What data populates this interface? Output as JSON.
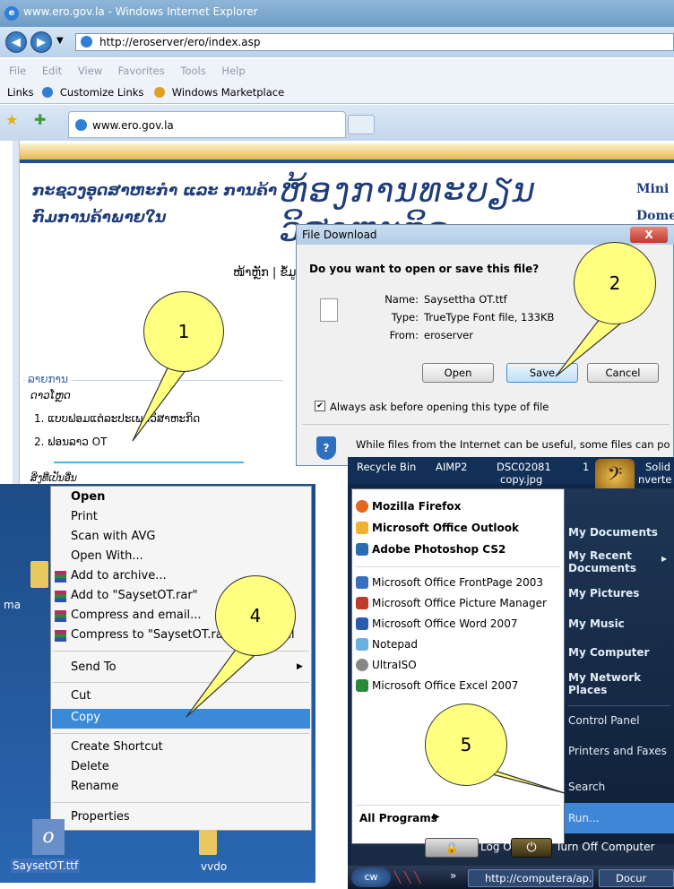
{
  "browser": {
    "title": "www.ero.gov.la - Windows Internet Explorer",
    "address": "http://eroserver/ero/index.asp",
    "menu": [
      "File",
      "Edit",
      "View",
      "Favorites",
      "Tools",
      "Help"
    ],
    "links_label": "Links",
    "links": [
      "Customize Links",
      "Windows Marketplace"
    ],
    "tab_label": "www.ero.gov.la"
  },
  "site": {
    "left_title_1": "ກະຊວງອຸດສາຫະກຳ ແລະ ການຄ້າ",
    "left_title_2": "ກົມການຄ້າພາຍໃນ",
    "big_title": "ຫ້ອງການທະບຽນວິສາຫະກິດ",
    "right_1": "Mini",
    "right_2": "Dome",
    "breadcrumb": "ໜ້າຫຼັກ | ຂໍ້ມູນຂ່າວ",
    "menu_title": "ລາຍການ",
    "menu_sub": "ດາວໂຫຼດ",
    "menu_item_1": "1. ແບບຟອມແຕ່ລະປະເພດວິສາຫະກິດ",
    "menu_item_2": "2. ຟອນລາວ OT",
    "menu_more": "ສິ່ງທີ່ເປັນອື່ນ"
  },
  "dialog": {
    "title": "File Download",
    "close": "X",
    "question": "Do you want to open or save this file?",
    "name_label": "Name:",
    "name_value": "Saysettha OT.ttf",
    "type_label": "Type:",
    "type_value": "TrueType Font file, 133KB",
    "from_label": "From:",
    "from_value": "eroserver",
    "open": "Open",
    "save": "Save",
    "cancel": "Cancel",
    "checkbox_checked": true,
    "checkbox_label": "Always ask before opening this type of file",
    "warning": "While files from the Internet can be useful, some files can potentially"
  },
  "context_menu": {
    "items": [
      "Open",
      "Print",
      "Scan with AVG",
      "Open With...",
      "Add to archive...",
      "Add to \"SaysetOT.rar\"",
      "Compress and email...",
      "Compress to \"SaysetOT.rar\" and email",
      "Send To",
      "Cut",
      "Copy",
      "Create Shortcut",
      "Delete",
      "Rename",
      "Properties"
    ],
    "desktop_left_label": "ma",
    "file_label": "SaysetOT.ttf",
    "folder_label": "vvdo"
  },
  "start_menu": {
    "desktop_icons": [
      "Recycle Bin",
      "AIMP2",
      "DSC02081",
      "copy.jpg",
      "1",
      "Solid",
      "nverte"
    ],
    "pinned": [
      "Mozilla Firefox",
      "Microsoft Office Outlook",
      "Adobe Photoshop CS2"
    ],
    "recent": [
      "Microsoft Office FrontPage 2003",
      "Microsoft Office Picture Manager",
      "Microsoft Office Word 2007",
      "Notepad",
      "UltraISO",
      "Microsoft Office Excel 2007"
    ],
    "all_programs": "All Programs",
    "right": [
      "My Documents",
      "My Recent Documents",
      "My Pictures",
      "My Music",
      "My Computer",
      "My Network Places",
      "Control Panel",
      "Printers and Faxes",
      "Search",
      "Run..."
    ],
    "log_off": "Log Off",
    "turn_off": "Turn Off Computer",
    "taskbar_items": [
      "http://computera/ap...",
      "Docur"
    ],
    "taskbar_more": "»"
  },
  "callouts": [
    "1",
    "2",
    "4",
    "5"
  ],
  "colors": {
    "callout": "#ffff80",
    "accent_blue": "#3b8ad8",
    "site_blue": "#1f3d7a"
  }
}
